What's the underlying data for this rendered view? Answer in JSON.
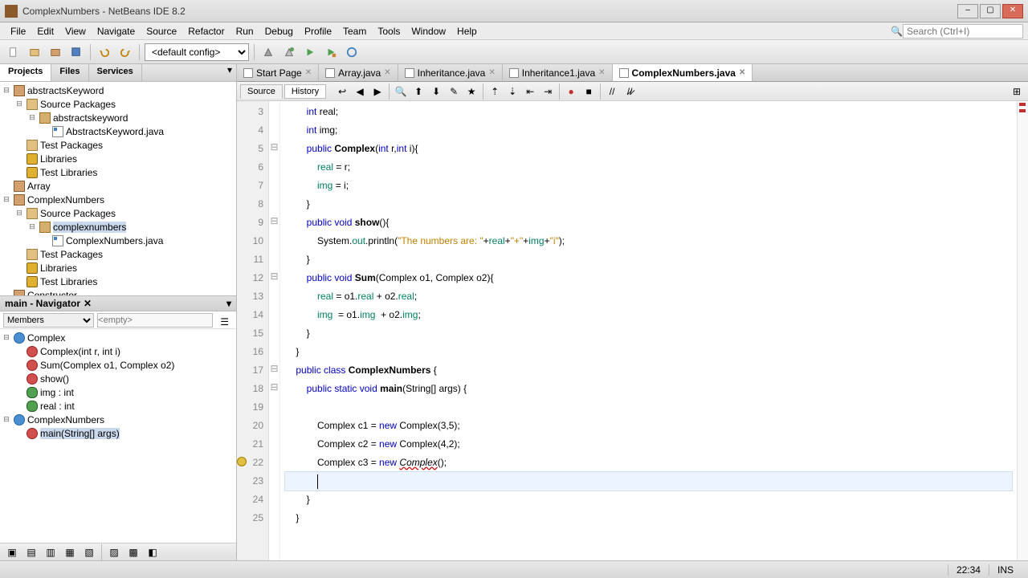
{
  "window": {
    "title": "ComplexNumbers - NetBeans IDE 8.2"
  },
  "menu": [
    "File",
    "Edit",
    "View",
    "Navigate",
    "Source",
    "Refactor",
    "Run",
    "Debug",
    "Profile",
    "Team",
    "Tools",
    "Window",
    "Help"
  ],
  "search_placeholder": "Search (Ctrl+I)",
  "config_selected": "<default config>",
  "left_tabs": [
    "Projects",
    "Files",
    "Services"
  ],
  "projects": [
    {
      "name": "abstractsKeyword",
      "expanded": true,
      "children": [
        {
          "name": "Source Packages",
          "type": "src",
          "expanded": true,
          "children": [
            {
              "name": "abstractskeyword",
              "type": "pkg",
              "expanded": true,
              "children": [
                {
                  "name": "AbstractsKeyword.java",
                  "type": "java"
                }
              ]
            }
          ]
        },
        {
          "name": "Test Packages",
          "type": "src"
        },
        {
          "name": "Libraries",
          "type": "lib"
        },
        {
          "name": "Test Libraries",
          "type": "lib"
        }
      ]
    },
    {
      "name": "Array",
      "expanded": false
    },
    {
      "name": "ComplexNumbers",
      "expanded": true,
      "children": [
        {
          "name": "Source Packages",
          "type": "src",
          "expanded": true,
          "children": [
            {
              "name": "complexnumbers",
              "type": "pkg",
              "expanded": true,
              "selected": true,
              "children": [
                {
                  "name": "ComplexNumbers.java",
                  "type": "java"
                }
              ]
            }
          ]
        },
        {
          "name": "Test Packages",
          "type": "src"
        },
        {
          "name": "Libraries",
          "type": "lib"
        },
        {
          "name": "Test Libraries",
          "type": "lib"
        }
      ]
    },
    {
      "name": "Constructor",
      "expanded": false
    }
  ],
  "navigator": {
    "title": "main - Navigator",
    "members_label": "Members",
    "empty_placeholder": "<empty>",
    "items": [
      {
        "label": "Complex",
        "type": "class",
        "children": [
          {
            "label": "Complex(int r, int i)",
            "type": "method"
          },
          {
            "label": "Sum(Complex o1, Complex o2)",
            "type": "method"
          },
          {
            "label": "show()",
            "type": "method"
          },
          {
            "label": "img : int",
            "type": "field"
          },
          {
            "label": "real : int",
            "type": "field"
          }
        ]
      },
      {
        "label": "ComplexNumbers",
        "type": "class",
        "children": [
          {
            "label": "main(String[] args)",
            "type": "method",
            "selected": true
          }
        ]
      }
    ]
  },
  "editor_tabs": [
    {
      "label": "Start Page"
    },
    {
      "label": "Array.java"
    },
    {
      "label": "Inheritance.java"
    },
    {
      "label": "Inheritance1.java"
    },
    {
      "label": "ComplexNumbers.java",
      "active": true
    }
  ],
  "editor_view_tabs": {
    "source": "Source",
    "history": "History"
  },
  "code": {
    "first_line": 3,
    "lines": [
      {
        "n": 3,
        "html": "        <span class='kw'>int</span> real;"
      },
      {
        "n": 4,
        "html": "        <span class='kw'>int</span> img;"
      },
      {
        "n": 5,
        "html": "        <span class='kw'>public</span> <span class='type'>Complex</span>(<span class='kw'>int</span> r,<span class='kw'>int</span> i){",
        "fold": true
      },
      {
        "n": 6,
        "html": "            <span class='field-ref'>real</span> = r;"
      },
      {
        "n": 7,
        "html": "            <span class='field-ref'>img</span> = i;"
      },
      {
        "n": 8,
        "html": "        }"
      },
      {
        "n": 9,
        "html": "        <span class='kw'>public</span> <span class='kw'>void</span> <span class='type'>show</span>(){",
        "fold": true
      },
      {
        "n": 10,
        "html": "            System.<span class='field-ref'>out</span>.println(<span class='str'>\"The numbers are: \"</span>+<span class='field-ref'>real</span>+<span class='str'>\"+\"</span>+<span class='field-ref'>img</span>+<span class='str'>\"i\"</span>);"
      },
      {
        "n": 11,
        "html": "        }"
      },
      {
        "n": 12,
        "html": "        <span class='kw'>public</span> <span class='kw'>void</span> <span class='type'>Sum</span>(Complex o1, Complex o2){",
        "fold": true
      },
      {
        "n": 13,
        "html": "            <span class='field-ref'>real</span> = o1.<span class='field-ref'>real</span> + o2.<span class='field-ref'>real</span>;"
      },
      {
        "n": 14,
        "html": "            <span class='field-ref'>img</span>  = o1.<span class='field-ref'>img</span>  + o2.<span class='field-ref'>img</span>;"
      },
      {
        "n": 15,
        "html": "        }"
      },
      {
        "n": 16,
        "html": "    }"
      },
      {
        "n": 17,
        "html": "    <span class='kw'>public</span> <span class='kw'>class</span> <span class='type'>ComplexNumbers</span> {",
        "fold": true
      },
      {
        "n": 18,
        "html": "        <span class='kw'>public</span> <span class='kw'>static</span> <span class='kw'>void</span> <span class='type'>main</span>(String[] args) {",
        "fold": true
      },
      {
        "n": 19,
        "html": ""
      },
      {
        "n": 20,
        "html": "            Complex c1 = <span class='kw'>new</span> Complex(3,5);"
      },
      {
        "n": 21,
        "html": "            Complex c2 = <span class='kw'>new</span> Complex(4,2);"
      },
      {
        "n": 22,
        "html": "            Complex c3 = <span class='kw'>new</span> <span class='err-under'>Complex</span>();",
        "error": true
      },
      {
        "n": 23,
        "html": "            <span class='cursor-blink'></span>",
        "highlight": true
      },
      {
        "n": 24,
        "html": "        }"
      },
      {
        "n": 25,
        "html": "    }"
      }
    ]
  },
  "status": {
    "pos": "22:34",
    "mode": "INS"
  }
}
